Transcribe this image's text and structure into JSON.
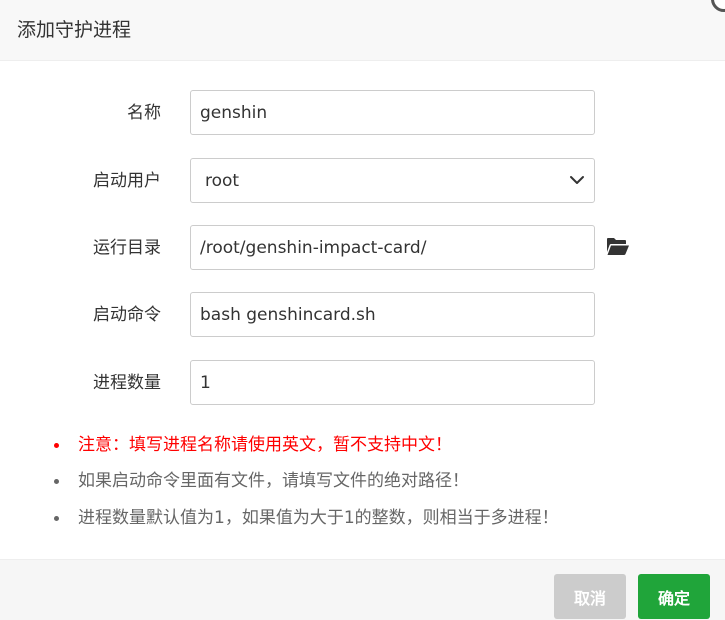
{
  "dialog": {
    "title": "添加守护进程"
  },
  "form": {
    "name": {
      "label": "名称",
      "value": "genshin"
    },
    "user": {
      "label": "启动用户",
      "selected": "root"
    },
    "run_dir": {
      "label": "运行目录",
      "value": "/root/genshin-impact-card/",
      "browse_icon": "folder-open-icon"
    },
    "command": {
      "label": "启动命令",
      "value": "bash genshincard.sh"
    },
    "process_count": {
      "label": "进程数量",
      "value": "1"
    }
  },
  "notes": [
    {
      "text": "注意：填写进程名称请使用英文，暂不支持中文！",
      "color": "#ff0000"
    },
    {
      "text": "如果启动命令里面有文件，请填写文件的绝对路径！",
      "color": "#666666"
    },
    {
      "text": "进程数量默认值为1，如果值为大于1的整数，则相当于多进程！",
      "color": "#666666"
    }
  ],
  "footer": {
    "cancel_label": "取消",
    "confirm_label": "确定"
  },
  "colors": {
    "accent": "#20a53a",
    "warning": "#ff0000",
    "cancel": "#cccccc"
  }
}
